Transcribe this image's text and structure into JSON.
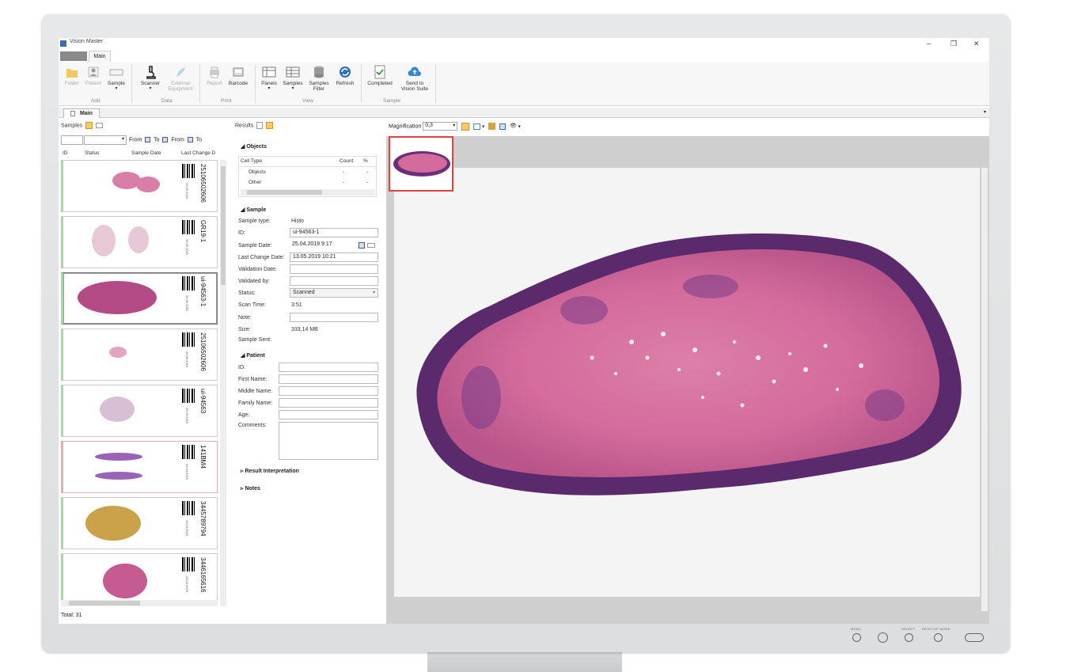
{
  "window": {
    "title": "Vision Master",
    "minimize": "–",
    "restore": "❐",
    "close": "✕"
  },
  "ribbon": {
    "tab": "Main",
    "buttons": [
      {
        "label": "Folder",
        "enabled": false
      },
      {
        "label": "Patient",
        "enabled": false
      },
      {
        "label": "Sample",
        "enabled": true
      },
      {
        "label": "Scanner",
        "enabled": true
      },
      {
        "label": "External\nEquipment",
        "enabled": false
      },
      {
        "label": "Report",
        "enabled": false
      },
      {
        "label": "Barcode",
        "enabled": true
      },
      {
        "label": "Panels",
        "enabled": true
      },
      {
        "label": "Samples",
        "enabled": true
      },
      {
        "label": "Samples\nFilter",
        "enabled": true
      },
      {
        "label": "Refresh",
        "enabled": true
      },
      {
        "label": "Completed",
        "enabled": true
      },
      {
        "label": "Send to\nVision Suite",
        "enabled": true
      }
    ],
    "groups": [
      "Add",
      "Data",
      "Print",
      "View",
      "Sample"
    ]
  },
  "doc_tab": "Main",
  "samples_panel": {
    "header": "Samples",
    "filter": {
      "from": "From",
      "to": "To",
      "from2": "From",
      "to2": "To"
    },
    "columns": [
      "ID",
      "Status",
      "Sample Date",
      "Last Change D"
    ],
    "items": [
      {
        "id": "25106502606",
        "date": "25.05.2019",
        "border": "green"
      },
      {
        "id": "GR19-1",
        "date": "25.05.2019",
        "border": "green"
      },
      {
        "id": "ui-94563-1",
        "date": "25.05.2019",
        "border": "green"
      },
      {
        "id": "25106502606",
        "date": "25.05.2019",
        "border": "green"
      },
      {
        "id": "ui-94563",
        "date": "25.05.2019",
        "border": "green"
      },
      {
        "id": "141BM4",
        "date": "25.04.2019",
        "border": "red"
      },
      {
        "id": "3445789794",
        "date": "25.04.2019",
        "border": "green"
      },
      {
        "id": "3446165616",
        "date": "24.04.2019",
        "border": "green"
      }
    ],
    "total": "Total: 31"
  },
  "results_panel": {
    "header": "Results",
    "objects_section": "Objects",
    "grid_columns": [
      "Cell Type",
      "Count",
      "%"
    ],
    "grid_rows": [
      {
        "type": "Objects",
        "count": "-",
        "pct": "-"
      },
      {
        "type": "Other",
        "count": "-",
        "pct": "-"
      }
    ],
    "sample_section": "Sample",
    "sample_type_label": "Sample type:",
    "sample_type": "Histo",
    "id_label": "ID:",
    "id": "ui-94563-1",
    "sample_date_label": "Sample Date:",
    "sample_date": "25.04.2019 9:17",
    "last_change_label": "Last Change Date:",
    "last_change": "13.05.2019 10:21",
    "validation_date_label": "Validation Date:",
    "validated_by_label": "Validated by:",
    "status_label": "Status:",
    "status": "Scanned",
    "scan_time_label": "Scan Time:",
    "scan_time": "3:51",
    "note_label": "Note:",
    "size_label": "Size:",
    "size": "333,14 MB",
    "sample_sent_label": "Sample Sent:",
    "patient_section": "Patient",
    "patient_fields": [
      "ID:",
      "First Name:",
      "Middle Name:",
      "Family Name:",
      "Age:",
      "Comments:"
    ],
    "result_interpretation": "Result Interpretation",
    "notes": "Notes"
  },
  "viewer": {
    "magnification_label": "Magnification",
    "magnification": "0,3"
  },
  "bezel": {
    "menu": "MENU",
    "select": "SELECT",
    "mode": "DESKTOP MODE"
  },
  "colors": {
    "tissue_pink": "#d66a9a",
    "tissue_purple": "#6a2f78",
    "accent": "#3b6db3"
  }
}
